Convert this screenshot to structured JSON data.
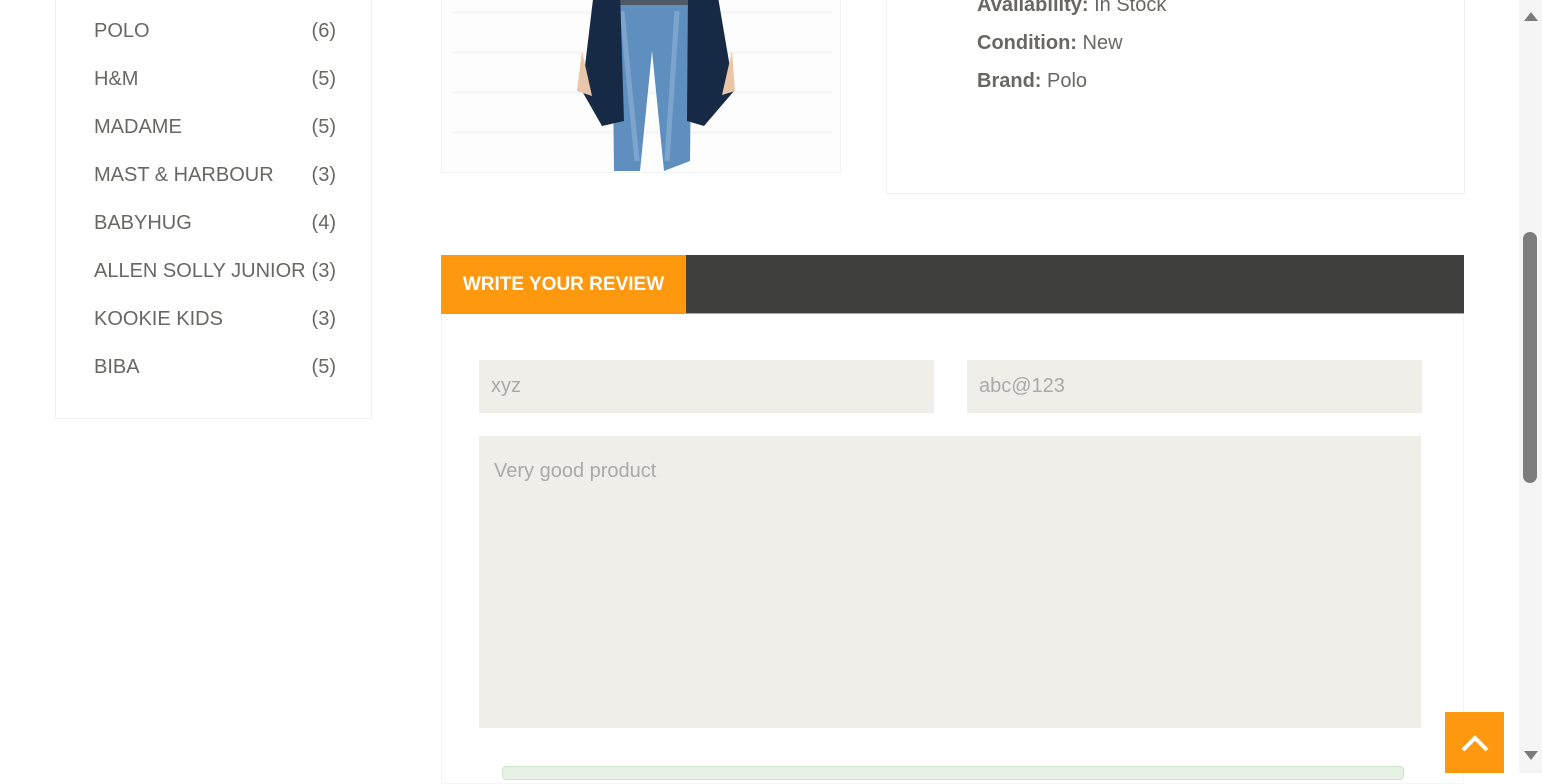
{
  "brands": [
    {
      "name": "POLO",
      "count": "(6)"
    },
    {
      "name": "H&M",
      "count": "(5)"
    },
    {
      "name": "MADAME",
      "count": "(5)"
    },
    {
      "name": "MAST & HARBOUR",
      "count": "(3)"
    },
    {
      "name": "BABYHUG",
      "count": "(4)"
    },
    {
      "name": "ALLEN SOLLY JUNIOR",
      "count": "(3)"
    },
    {
      "name": "KOOKIE KIDS",
      "count": "(3)"
    },
    {
      "name": "BIBA",
      "count": "(5)"
    }
  ],
  "product": {
    "availability_label": "Availability:",
    "availability_value": "In Stock",
    "condition_label": "Condition:",
    "condition_value": "New",
    "brand_label": "Brand:",
    "brand_value": "Polo"
  },
  "review": {
    "tab_label": "WRITE YOUR REVIEW",
    "name_value": "xyz",
    "email_value": "abc@123",
    "message_value": "Very good product"
  },
  "icons": {
    "scroll_top": "chevron-up-icon"
  },
  "colors": {
    "accent": "#fe980f",
    "tabbar": "#40403e",
    "field_bg": "#efeee8"
  }
}
